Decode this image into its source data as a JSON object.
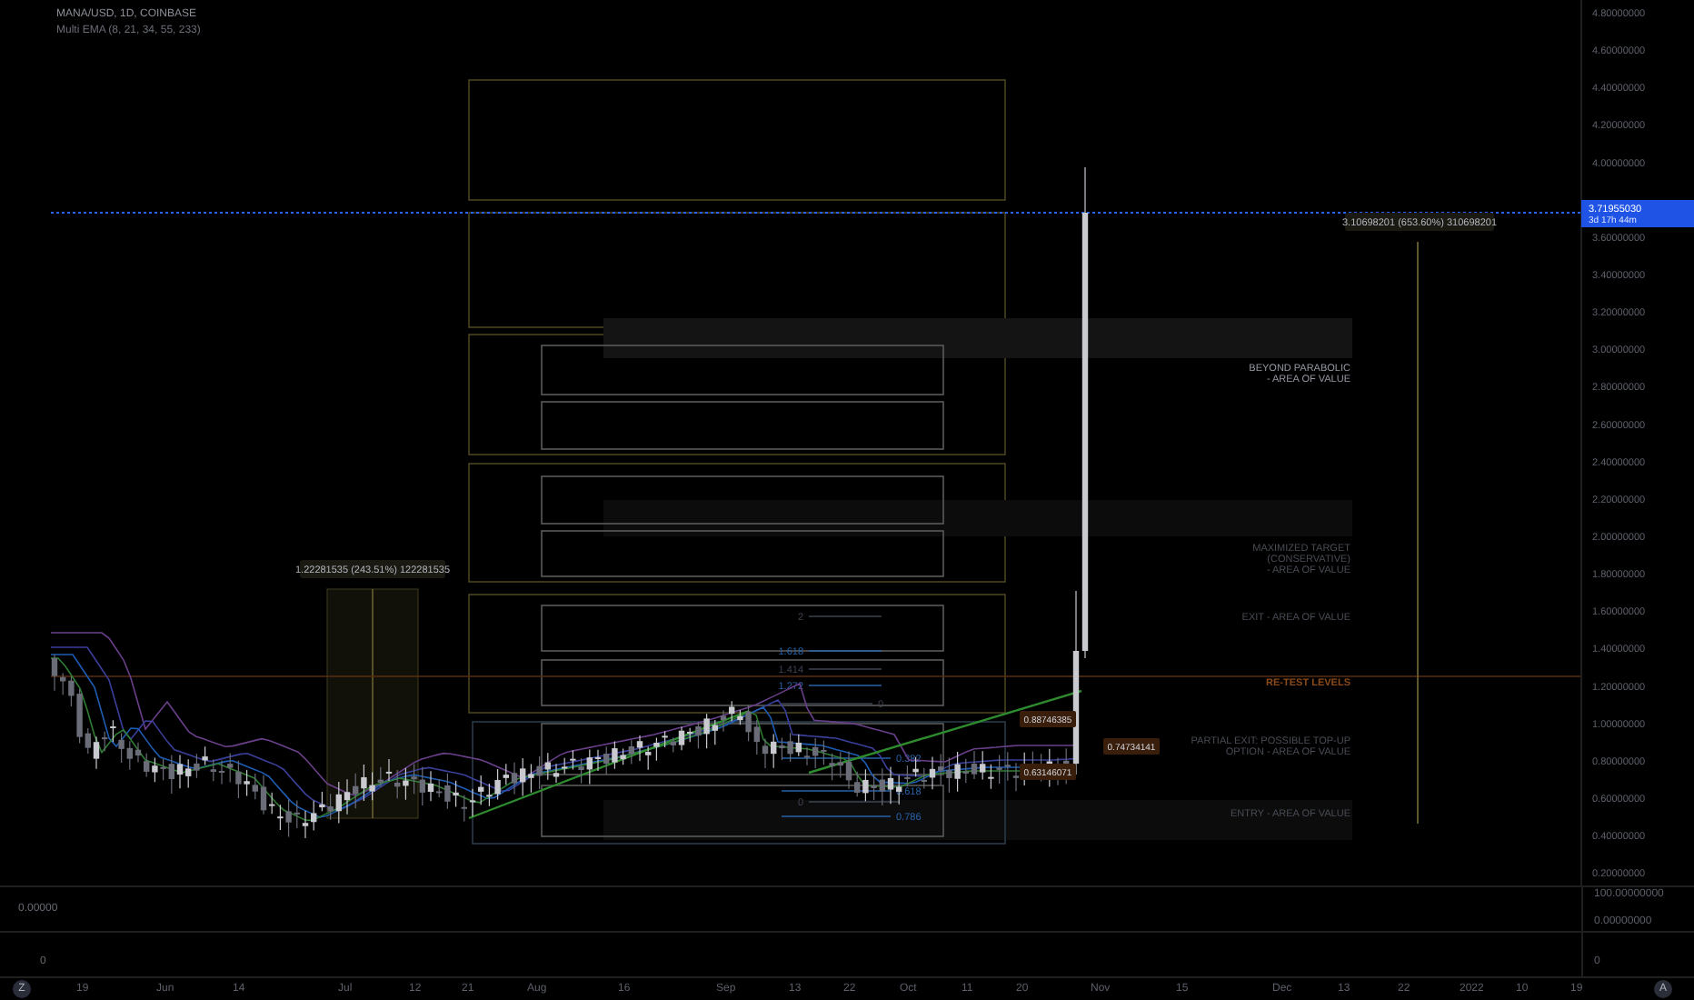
{
  "header": {
    "symbol": "MANA/USD, 1D, COINBASE",
    "indicator": "Multi EMA (8, 21, 34, 55, 233)"
  },
  "price_axis": [
    "4.80000000",
    "4.60000000",
    "4.40000000",
    "4.20000000",
    "4.00000000",
    "3.60000000",
    "3.40000000",
    "3.20000000",
    "3.00000000",
    "2.80000000",
    "2.60000000",
    "2.40000000",
    "2.20000000",
    "2.00000000",
    "1.80000000",
    "1.60000000",
    "1.40000000",
    "1.20000000",
    "1.00000000",
    "0.80000000",
    "0.60000000",
    "0.40000000",
    "0.20000000"
  ],
  "last_price": {
    "value": "3.71955030",
    "countdown": "3d 17h 44m"
  },
  "measures": [
    {
      "label": "3.10698201 (653.60%) 310698201"
    },
    {
      "label": "1.22281535 (243.51%) 122281535"
    }
  ],
  "zones": [
    {
      "kind": "bright",
      "lines": [
        "BEYOND PARABOLIC",
        "- AREA OF VALUE"
      ]
    },
    {
      "kind": "dim",
      "lines": [
        "MAXIMIZED TARGET",
        "(CONSERVATIVE)",
        "- AREA OF VALUE"
      ]
    },
    {
      "kind": "dim",
      "lines": [
        "EXIT - AREA OF VALUE"
      ]
    },
    {
      "kind": "accent",
      "lines": [
        "RE-TEST LEVELS"
      ]
    },
    {
      "kind": "dim",
      "lines": [
        "PARTIAL EXIT: POSSIBLE TOP-UP",
        "OPTION - AREA OF VALUE"
      ]
    },
    {
      "kind": "dim",
      "lines": [
        "ENTRY - AREA OF VALUE"
      ]
    }
  ],
  "fib_levels": [
    {
      "label": "2",
      "kind": "dim"
    },
    {
      "label": "1.618",
      "kind": "bright"
    },
    {
      "label": "1.414",
      "kind": "dim"
    },
    {
      "label": "1.272",
      "kind": "bright"
    },
    {
      "label": "0",
      "kind": "dim"
    },
    {
      "label": "0.382",
      "kind": "bright"
    },
    {
      "label": "0.618",
      "kind": "bright"
    },
    {
      "label": "0",
      "kind": "dim"
    },
    {
      "label": "0.786",
      "kind": "bright"
    }
  ],
  "price_tags": [
    "0.88746385",
    "0.63146071",
    "0.74734141"
  ],
  "pane_2": {
    "label": "0.00000",
    "axis": [
      "100.00000000",
      "0.00000000"
    ]
  },
  "pane_3": {
    "label": "0",
    "axis": [
      "0"
    ]
  },
  "time_axis": [
    "19",
    "Jun",
    "14",
    "Jul",
    "12",
    "21",
    "Aug",
    "16",
    "Sep",
    "13",
    "22",
    "Oct",
    "11",
    "20",
    "Nov",
    "15",
    "Dec",
    "13",
    "22",
    "2022",
    "10",
    "19"
  ],
  "buttons": {
    "left": "Z",
    "right": "A"
  }
}
